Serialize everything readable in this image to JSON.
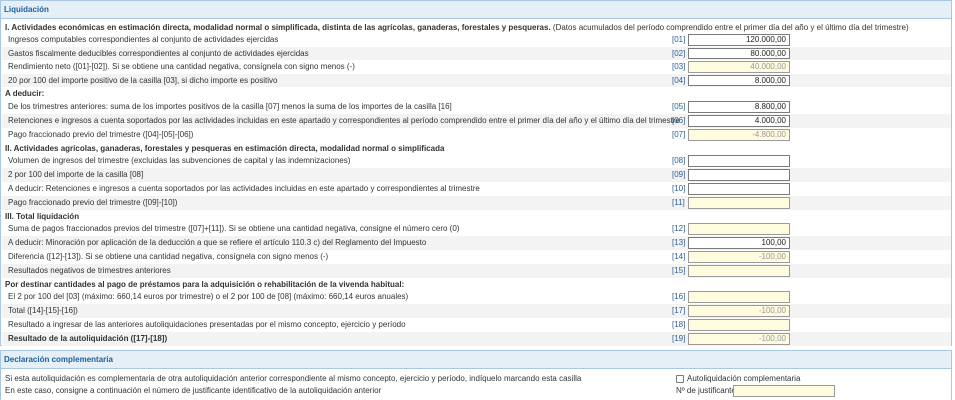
{
  "liquidacion": {
    "header": "Liquidación",
    "sections": [
      {
        "id": "s1",
        "title": "I. Actividades económicas en estimación directa, modalidad normal o simplificada, distinta de las agrícolas, ganaderas, forestales y pesqueras.",
        "note": " (Datos acumulados del período comprendido entre el primer día del año y el último día del trimestre)"
      },
      {
        "id": "s1b",
        "title": "A deducir:",
        "note": ""
      },
      {
        "id": "s2",
        "title": "II. Actividades agrícolas, ganaderas, forestales y pesqueras en estimación directa, modalidad normal o simplificada",
        "note": ""
      },
      {
        "id": "s3",
        "title": "III. Total liquidación",
        "note": ""
      },
      {
        "id": "s4",
        "title": "Por destinar cantidades al pago de préstamos para la adquisición o rehabilitación de la vivenda habitual:",
        "note": ""
      }
    ],
    "rows": [
      {
        "code": "[01]",
        "label": "Ingresos computables correspondientes al conjunto de actividades ejercidas",
        "value": "120.000,00",
        "calc": false
      },
      {
        "code": "[02]",
        "label": "Gastos fiscalmente deducibles correspondientes al conjunto de actividades ejercidas",
        "value": "80.000,00",
        "calc": false
      },
      {
        "code": "[03]",
        "label": "Rendimiento neto ([01]-[02]). Si se obtiene una cantidad negativa, consígnela con signo menos (-)",
        "value": "40.000,00",
        "calc": true
      },
      {
        "code": "[04]",
        "label": "20 por 100 del importe positivo de la casilla [03], si dicho importe es positivo",
        "value": "8.000,00",
        "calc": false
      },
      {
        "code": "[05]",
        "label": "De los trimestres anteriores: suma de los importes positivos de la casilla [07] menos la suma de los importes de la casilla [16]",
        "value": "8.800,00",
        "calc": false
      },
      {
        "code": "[06]",
        "label": "Retenciones e ingresos a cuenta soportados por las actividades incluidas en este apartado y correspondientes al período comprendido entre el primer día del año y el último día del trimestre",
        "value": "4.000,00",
        "calc": false
      },
      {
        "code": "[07]",
        "label": "Pago fraccionado previo del trimestre ([04]-[05]-[06])",
        "value": "-4.800,00",
        "calc": true
      },
      {
        "code": "[08]",
        "label": "Volumen de ingresos del trimestre (excluidas las subvenciones de capital y las indemnizaciones)",
        "value": "",
        "calc": false
      },
      {
        "code": "[09]",
        "label": "2 por 100 del importe de la casilla [08]",
        "value": "",
        "calc": false
      },
      {
        "code": "[10]",
        "label": "A deducir: Retenciones e ingresos a cuenta soportados por las actividades incluidas en este apartado y correspondientes al trimestre",
        "value": "",
        "calc": false
      },
      {
        "code": "[11]",
        "label": "Pago fraccionado previo del trimestre ([09]-[10])",
        "value": "",
        "calc": true
      },
      {
        "code": "[12]",
        "label": "Suma de pagos fraccionados previos del trimestre ([07]+[11]). Si se obtiene una cantidad negativa, consigne el número cero (0)",
        "value": "",
        "calc": true
      },
      {
        "code": "[13]",
        "label": "A deducir: Minoración por aplicación de la deducción a que se refiere el artículo 110.3 c) del Reglamento del Impuesto",
        "value": "100,00",
        "calc": false
      },
      {
        "code": "[14]",
        "label": "Diferencia ([12]-[13]). Si se obtiene una cantidad negativa, consígnela con signo menos (-)",
        "value": "-100,00",
        "calc": true
      },
      {
        "code": "[15]",
        "label": "Resultados negativos de trimestres anteriores",
        "value": "",
        "calc": true
      },
      {
        "code": "[16]",
        "label": "El 2 por 100 del [03] (máximo: 660,14 euros por trimestre) o el 2 por 100 de [08] (máximo: 660,14 euros anuales)",
        "value": "",
        "calc": true
      },
      {
        "code": "[17]",
        "label": "Total ([14]-[15]-[16])",
        "value": "-100,00",
        "calc": true
      },
      {
        "code": "[18]",
        "label": "Resultado a ingresar de las anteriores autoliquidaciones presentadas por el mismo concepto, ejercicio y período",
        "value": "",
        "calc": true
      },
      {
        "code": "[19]",
        "label": "Resultado de la autoliquidación ([17]-[18])",
        "value": "-100,00",
        "calc": true
      }
    ]
  },
  "complementaria": {
    "header": "Declaración complementaria",
    "row1_label": "Si esta autoliquidación es complementaria de otra autoliquidación anterior correspondiente al mismo concepto, ejercicio y período, indíquelo marcando esta casilla",
    "checkbox_label": "Autoliquidación complementaria",
    "checkbox_checked": false,
    "row2_label": "En este caso, consigne a continuación el número de justificante identificativo de la autoliquidación anterior",
    "justificante_label": "Nº de justificante",
    "justificante_value": ""
  }
}
